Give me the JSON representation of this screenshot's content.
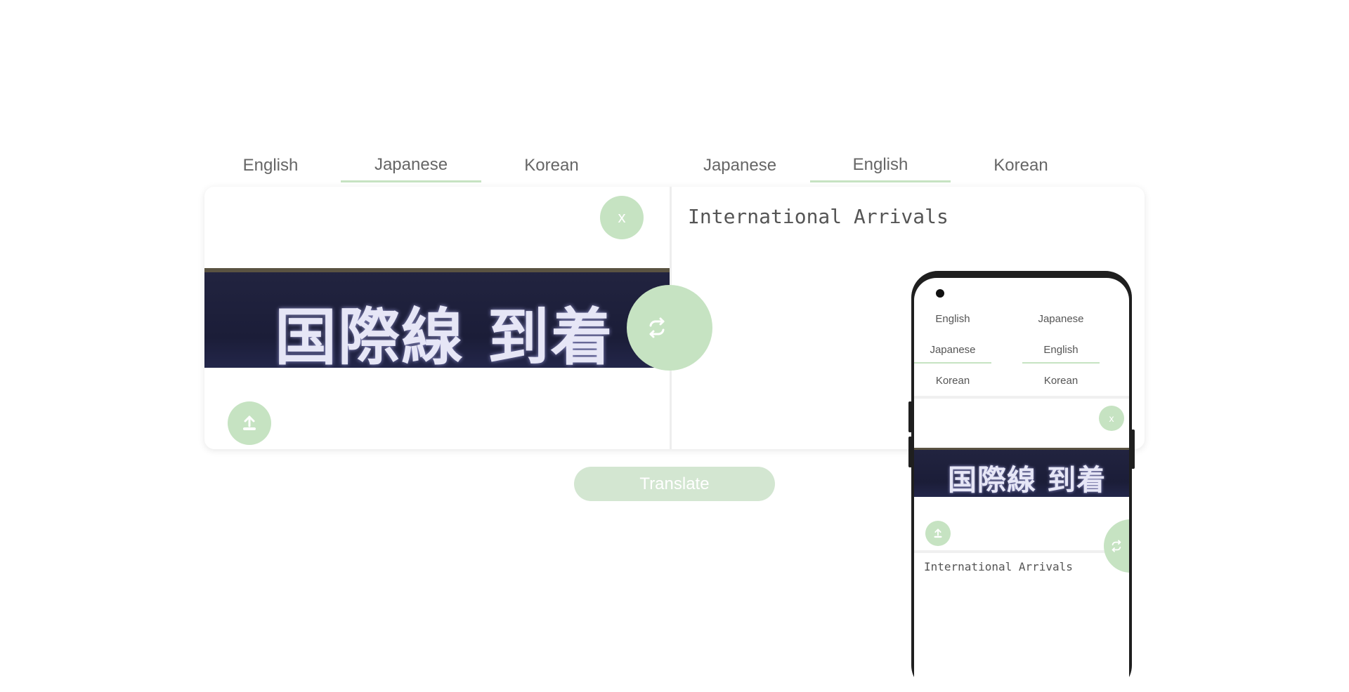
{
  "source_tabs": [
    "English",
    "Japanese",
    "Korean"
  ],
  "target_tabs": [
    "Japanese",
    "English",
    "Korean"
  ],
  "active_source": "Japanese",
  "active_target": "English",
  "clear_label": "x",
  "sign_text": "国際線 到着",
  "output_text": "International Arrivals",
  "translate_label": "Translate",
  "icons": {
    "upload": "upload-icon",
    "swap": "swap-icon"
  },
  "colors": {
    "accent": "#c6e3c2",
    "translate_button": "#d3e6d1"
  }
}
